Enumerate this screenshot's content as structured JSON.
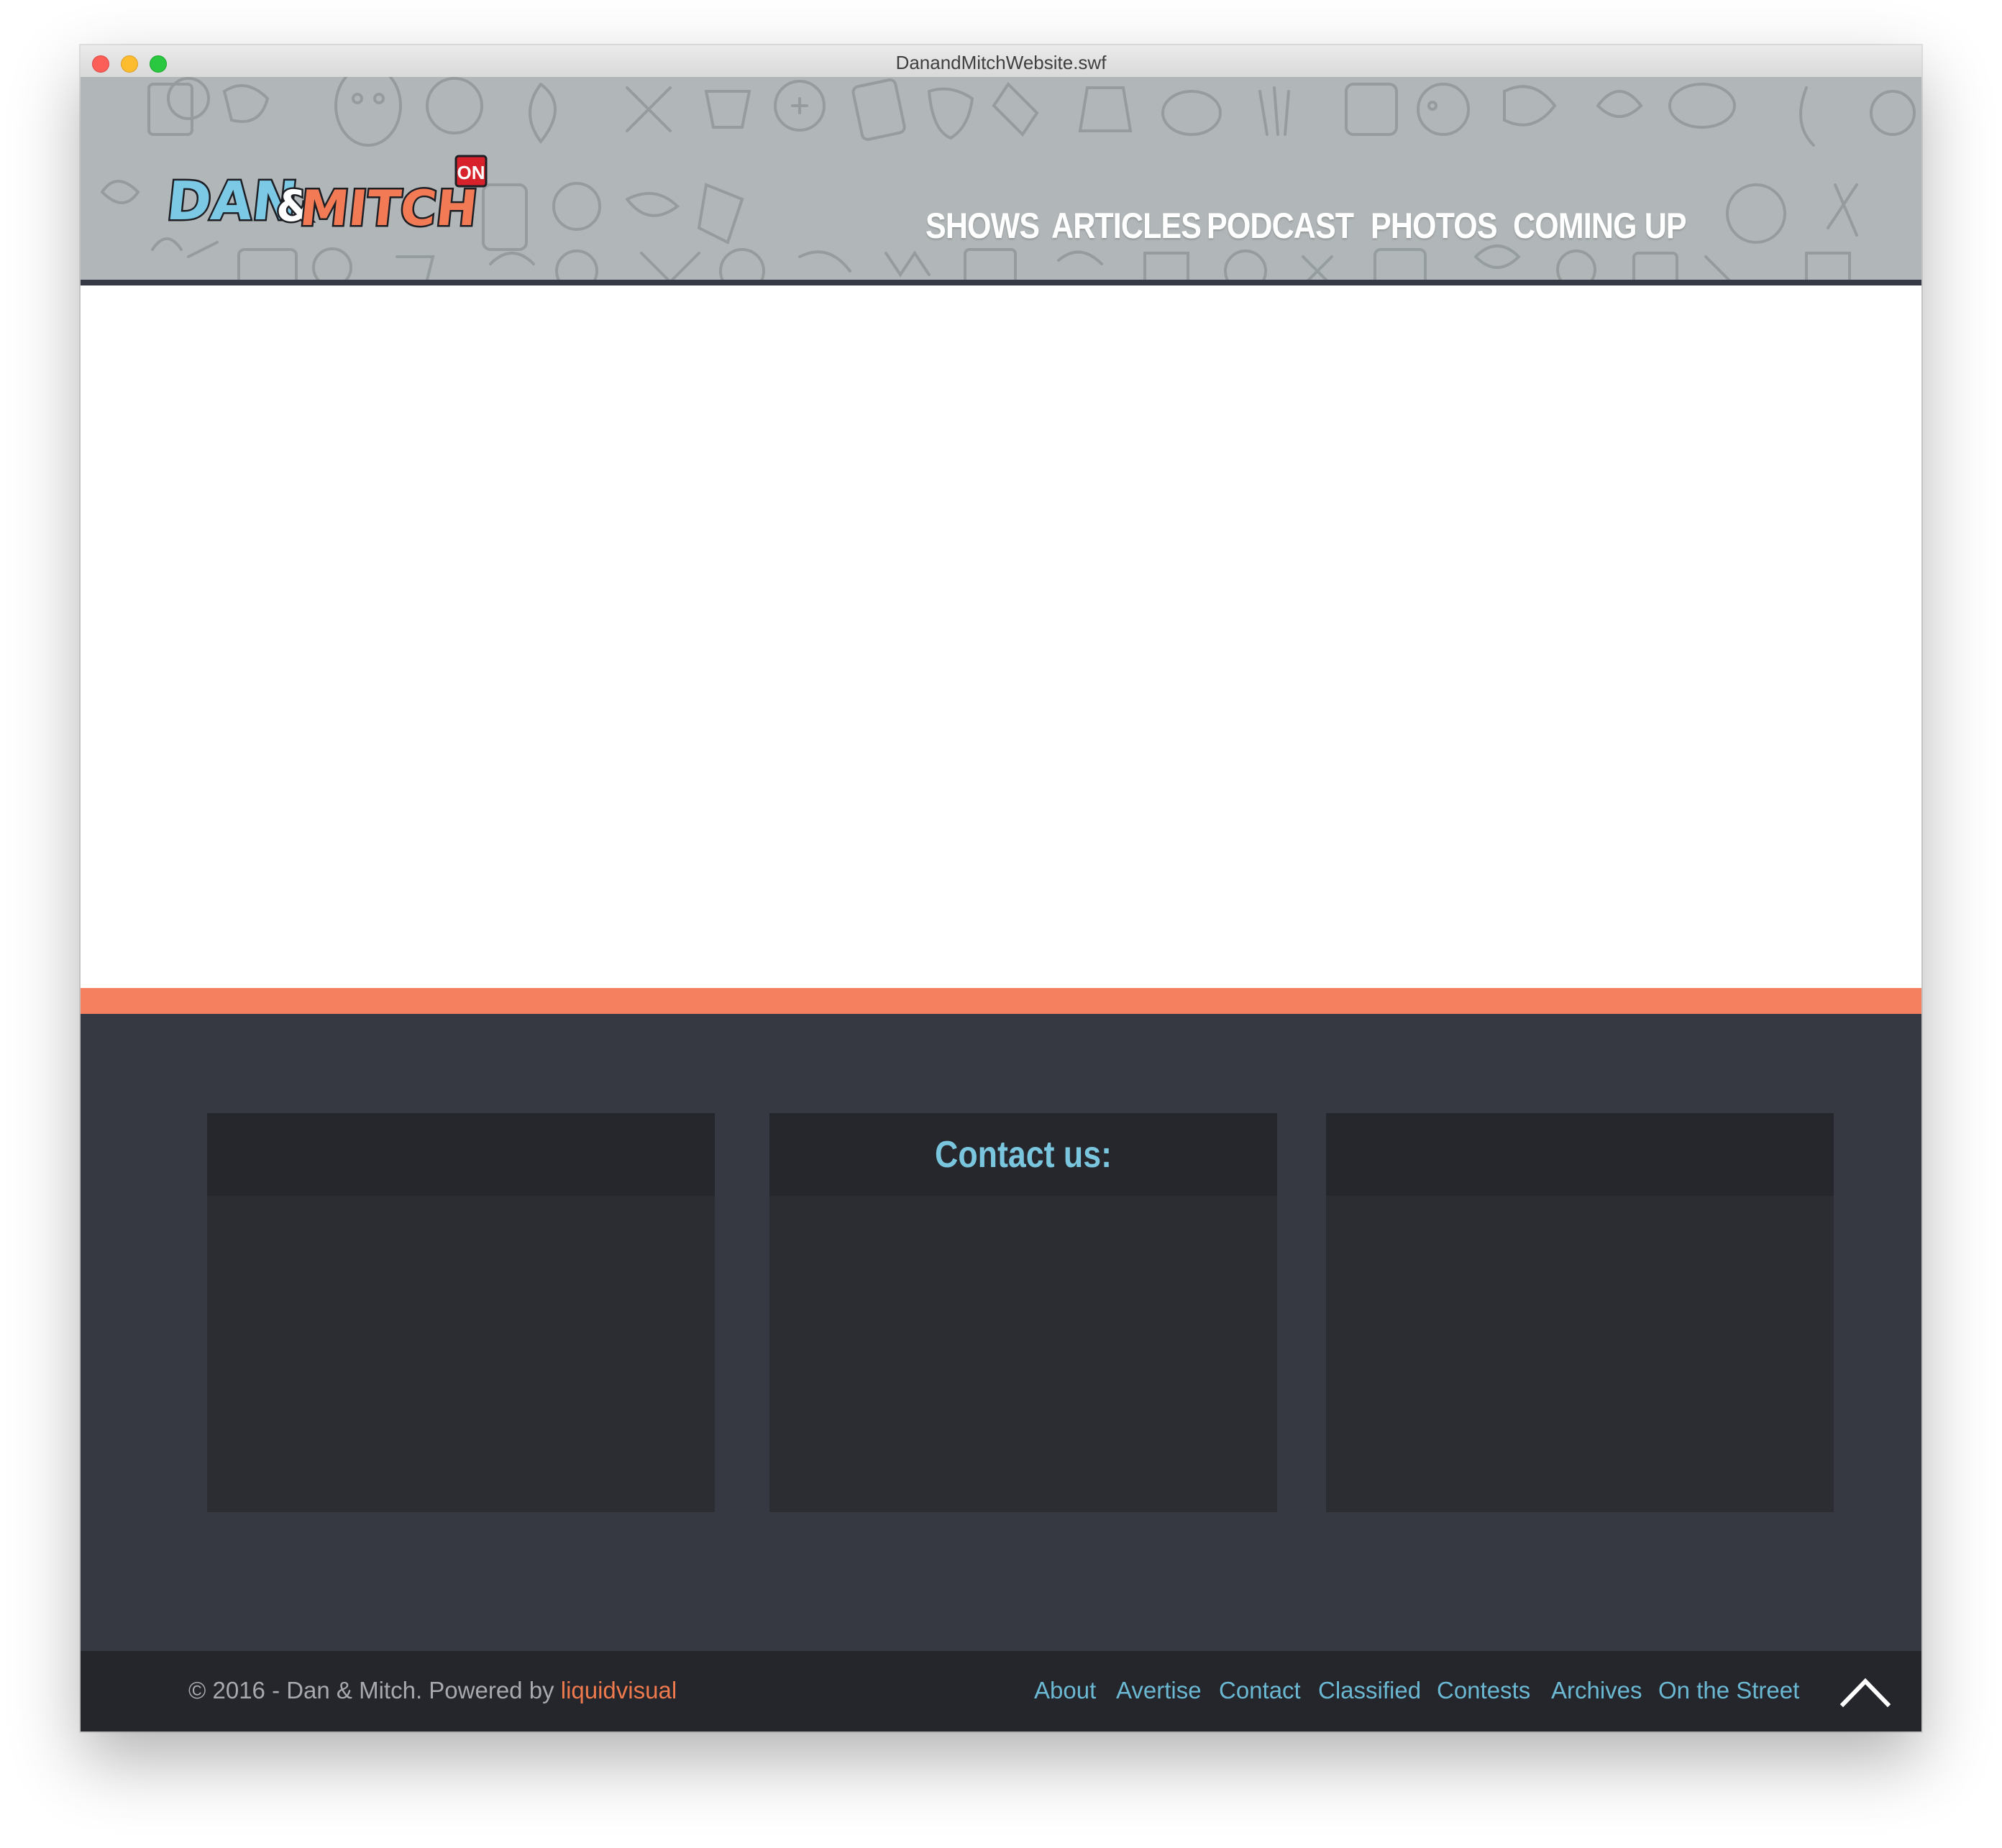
{
  "window": {
    "title": "DanandMitchWebsite.swf"
  },
  "header": {
    "logo": {
      "dan": "DAN",
      "amp": "&",
      "mitch": "MITCH",
      "badge": "ON"
    },
    "nav": [
      "SHOWS",
      "ARTICLES",
      "PODCAST",
      "PHOTOS",
      "COMING UP"
    ]
  },
  "footer": {
    "panels": [
      {
        "title": ""
      },
      {
        "title": "Contact us:"
      },
      {
        "title": ""
      }
    ]
  },
  "bottom_bar": {
    "copyright_prefix": "© 2016 - Dan & Mitch. Powered by ",
    "powered_by": "liquidvisual",
    "links": [
      "About",
      "Avertise",
      "Contact",
      "Classified",
      "Contests",
      "Archives",
      "On the Street"
    ],
    "to_top_icon": "chevron-up-icon"
  },
  "colors": {
    "header_bg": "#b1b7b8",
    "accent_orange": "#f48060",
    "footer_bg": "#363941",
    "panel_bg": "#2c2d33",
    "link_blue": "#6bb8d3",
    "brand_orange": "#ef7a4e"
  }
}
